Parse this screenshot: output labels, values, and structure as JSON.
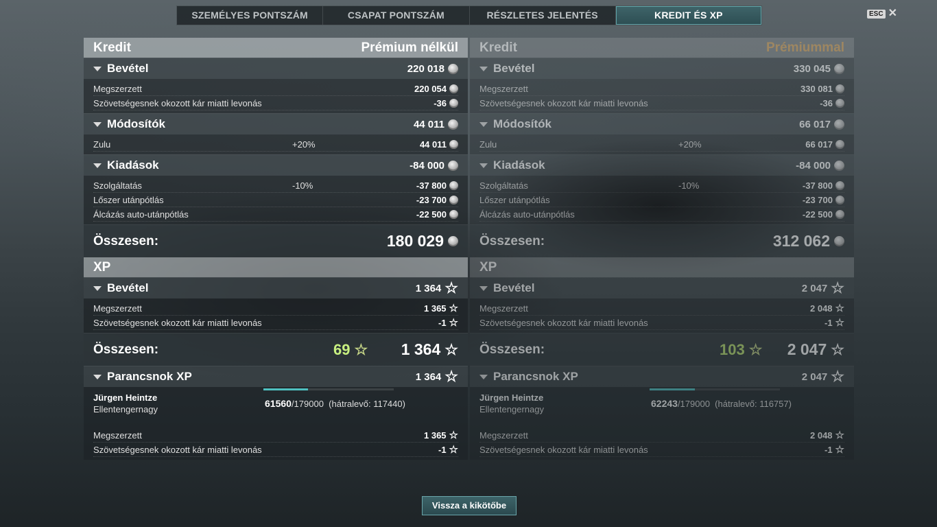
{
  "tabs": [
    "SZEMÉLYES PONTSZÁM",
    "CSAPAT PONTSZÁM",
    "RÉSZLETES JELENTÉS",
    "KREDIT ÉS XP"
  ],
  "esc": {
    "key": "ESC",
    "close": "✕"
  },
  "panels": [
    {
      "credit_title": "Kredit",
      "mode": "Prémium nélkül",
      "income": {
        "label": "Bevétel",
        "value": "220 018"
      },
      "income_items": [
        {
          "name": "Megszerzett",
          "value": "220 054"
        },
        {
          "name": "Szövetségesnek okozott kár miatti levonás",
          "value": "-36"
        }
      ],
      "modifiers": {
        "label": "Módosítók",
        "value": "44 011"
      },
      "modifier_items": [
        {
          "name": "Zulu",
          "pct": "+20%",
          "value": "44 011"
        }
      ],
      "expenses": {
        "label": "Kiadások",
        "value": "-84 000"
      },
      "expense_items": [
        {
          "name": "Szolgáltatás",
          "pct": "-10%",
          "value": "-37 800"
        },
        {
          "name": "Lőszer utánpótlás",
          "value": "-23 700"
        },
        {
          "name": "Álcázás auto-utánpótlás",
          "value": "-22 500"
        }
      ],
      "credit_total": {
        "label": "Összesen:",
        "value": "180 029"
      },
      "xp_title": "XP",
      "xp_income": {
        "label": "Bevétel",
        "value": "1 364"
      },
      "xp_items": [
        {
          "name": "Megszerzett",
          "value": "1 365"
        },
        {
          "name": "Szövetségesnek okozott kár miatti levonás",
          "value": "-1"
        }
      ],
      "xp_total": {
        "label": "Összesen:",
        "bonus": "69",
        "value": "1 364"
      },
      "commander": {
        "label": "Parancsnok XP",
        "value": "1 364"
      },
      "commander_info": {
        "name": "Jürgen Heintze",
        "rank": "Ellentengernagy",
        "xp": "61560",
        "xp_max": "/179000",
        "remaining": "(hátralevő: 117440)",
        "progress": 0.344
      },
      "commander_items": [
        {
          "name": "Megszerzett",
          "value": "1 365"
        },
        {
          "name": "Szövetségesnek okozott kár miatti levonás",
          "value": "-1"
        }
      ]
    },
    {
      "credit_title": "Kredit",
      "mode": "Prémiummal",
      "income": {
        "label": "Bevétel",
        "value": "330 045"
      },
      "income_items": [
        {
          "name": "Megszerzett",
          "value": "330 081"
        },
        {
          "name": "Szövetségesnek okozott kár miatti levonás",
          "value": "-36"
        }
      ],
      "modifiers": {
        "label": "Módosítók",
        "value": "66 017"
      },
      "modifier_items": [
        {
          "name": "Zulu",
          "pct": "+20%",
          "value": "66 017"
        }
      ],
      "expenses": {
        "label": "Kiadások",
        "value": "-84 000"
      },
      "expense_items": [
        {
          "name": "Szolgáltatás",
          "pct": "-10%",
          "value": "-37 800"
        },
        {
          "name": "Lőszer utánpótlás",
          "value": "-23 700"
        },
        {
          "name": "Álcázás auto-utánpótlás",
          "value": "-22 500"
        }
      ],
      "credit_total": {
        "label": "Összesen:",
        "value": "312 062"
      },
      "xp_title": "XP",
      "xp_income": {
        "label": "Bevétel",
        "value": "2 047"
      },
      "xp_items": [
        {
          "name": "Megszerzett",
          "value": "2 048"
        },
        {
          "name": "Szövetségesnek okozott kár miatti levonás",
          "value": "-1"
        }
      ],
      "xp_total": {
        "label": "Összesen:",
        "bonus": "103",
        "value": "2 047"
      },
      "commander": {
        "label": "Parancsnok XP",
        "value": "2 047"
      },
      "commander_info": {
        "name": "Jürgen Heintze",
        "rank": "Ellentengernagy",
        "xp": "62243",
        "xp_max": "/179000",
        "remaining": "(hátralevő: 116757)",
        "progress": 0.348
      },
      "commander_items": [
        {
          "name": "Megszerzett",
          "value": "2 048"
        },
        {
          "name": "Szövetségesnek okozott kár miatti levonás",
          "value": "-1"
        }
      ]
    }
  ],
  "back_button": "Vissza a kikötőbe",
  "colors": {
    "accent": "#4fc0c0",
    "premium": "#d9a860",
    "bonus": "#c8f080"
  },
  "icons": {
    "credit": "coin-icon",
    "xp": "star-icon",
    "expand": "triangle-down-icon"
  }
}
